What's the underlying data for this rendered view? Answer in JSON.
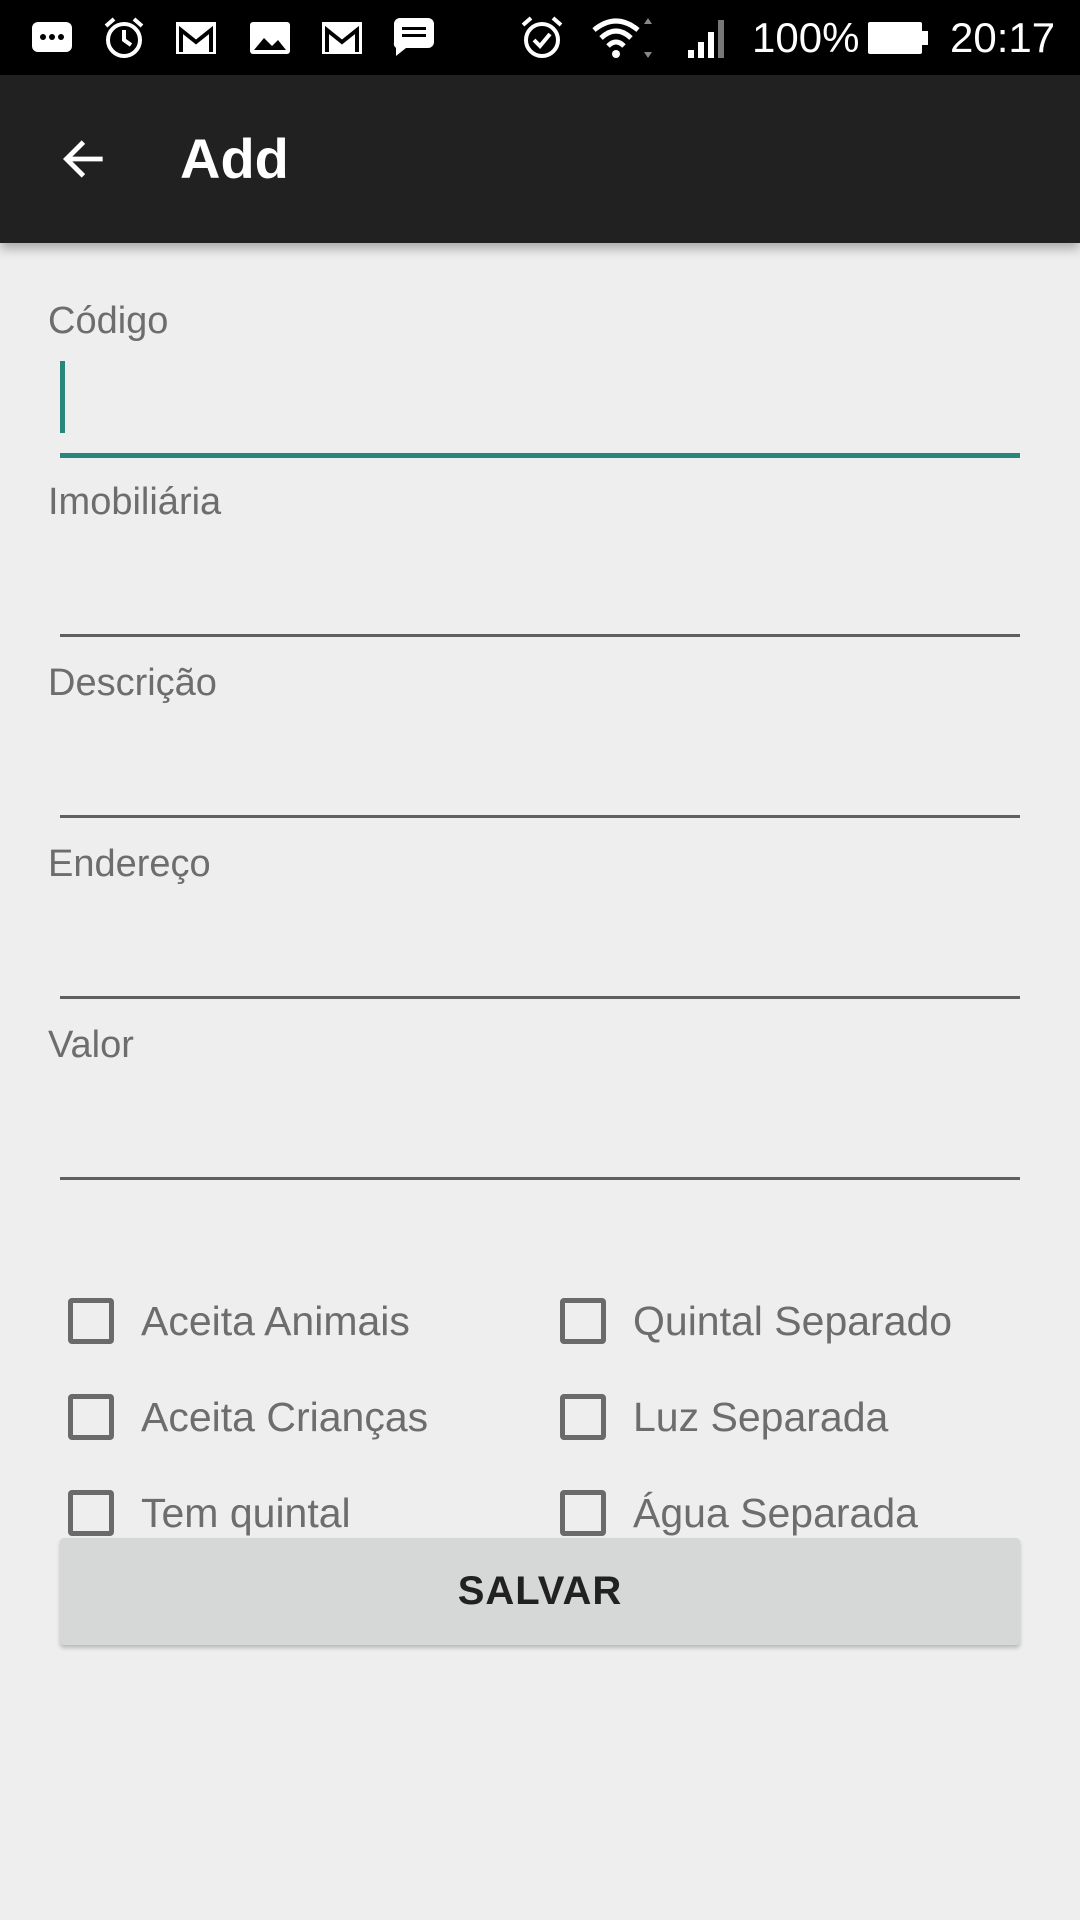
{
  "status_bar": {
    "battery": "100%",
    "time": "20:17",
    "left_icons": [
      "chat-icon",
      "alarm-clock-icon",
      "gmail-icon",
      "photo-icon",
      "gmail-icon",
      "message-icon"
    ],
    "right_icons": [
      "alarm-icon",
      "wifi-icon",
      "cell-signal-icon",
      "battery-icon"
    ]
  },
  "app_bar": {
    "title": "Add",
    "back_icon": "arrow-back-icon",
    "background": "#212121"
  },
  "form": {
    "fields": [
      {
        "label": "Código",
        "value": "",
        "focused": true
      },
      {
        "label": "Imobiliária",
        "value": ""
      },
      {
        "label": "Descrição",
        "value": ""
      },
      {
        "label": "Endereço",
        "value": ""
      },
      {
        "label": "Valor",
        "value": ""
      }
    ],
    "checkboxes": [
      {
        "label": "Aceita Animais",
        "checked": false
      },
      {
        "label": "Quintal Separado",
        "checked": false
      },
      {
        "label": "Aceita Crianças",
        "checked": false
      },
      {
        "label": "Luz Separada",
        "checked": false
      },
      {
        "label": "Tem quintal",
        "checked": false
      },
      {
        "label": "Água Separada",
        "checked": false
      }
    ],
    "save_label": "SALVAR"
  },
  "colors": {
    "accent": "#26877a",
    "background": "#eeeeee",
    "button": "#d6d7d7"
  }
}
